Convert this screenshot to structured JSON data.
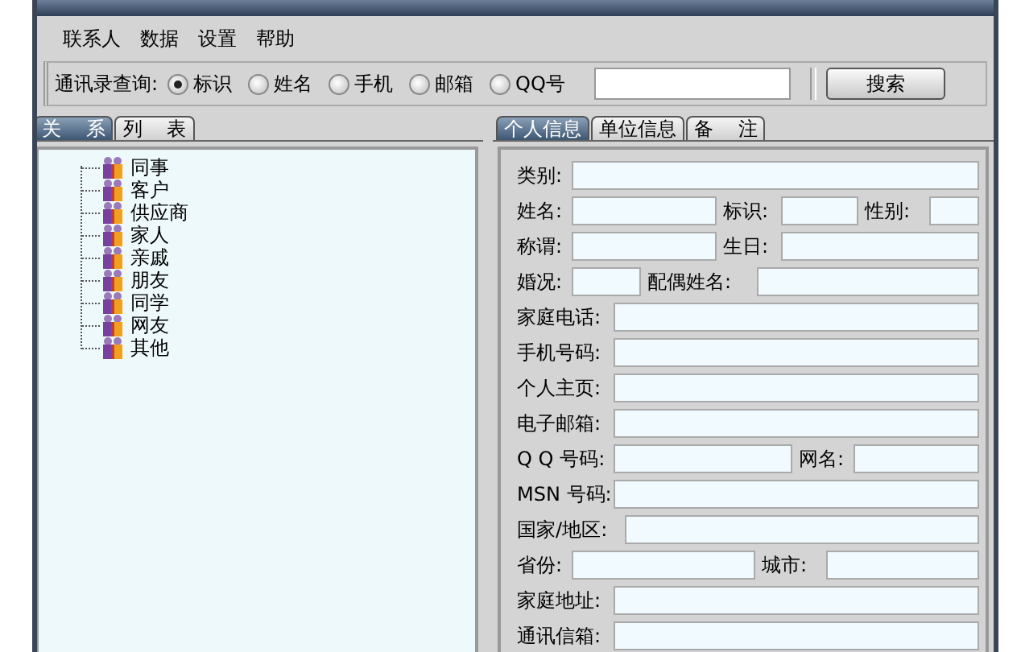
{
  "menu": [
    "联系人",
    "数据",
    "设置",
    "帮助"
  ],
  "search": {
    "label": "通讯录查询:",
    "options": [
      {
        "label": "标识",
        "selected": true
      },
      {
        "label": "姓名",
        "selected": false
      },
      {
        "label": "手机",
        "selected": false
      },
      {
        "label": "邮箱",
        "selected": false
      },
      {
        "label": "QQ号",
        "selected": false
      }
    ],
    "button": "搜索"
  },
  "left_tabs": [
    {
      "label": "关    系",
      "selected": true
    },
    {
      "label": "列    表",
      "selected": false
    }
  ],
  "tree": [
    "同事",
    "客户",
    "供应商",
    "家人",
    "亲戚",
    "朋友",
    "同学",
    "网友",
    "其他"
  ],
  "right_tabs": [
    {
      "label": "个人信息",
      "selected": true
    },
    {
      "label": "单位信息",
      "selected": false
    },
    {
      "label": "备    注",
      "selected": false
    }
  ],
  "form_rows": [
    [
      "类别:"
    ],
    [
      "姓名:",
      "标识:",
      "性别:"
    ],
    [
      "称谓:",
      "生日:"
    ],
    [
      "婚况:",
      "配偶姓名:"
    ],
    [
      "家庭电话:"
    ],
    [
      "手机号码:"
    ],
    [
      "个人主页:"
    ],
    [
      "电子邮箱:"
    ],
    [
      "Q Q 号码:",
      "网名:"
    ],
    [
      "MSN 号码:"
    ],
    [
      "国家/地区:"
    ],
    [
      "省份:",
      "城市:"
    ],
    [
      "家庭地址:"
    ],
    [
      "通讯信箱:"
    ]
  ]
}
